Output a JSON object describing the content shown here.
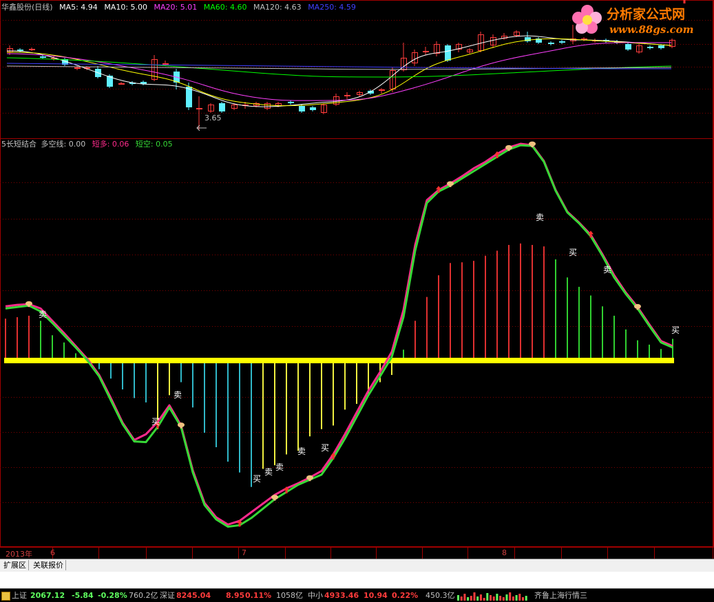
{
  "price_header": {
    "name": "华鑫股份(日线)",
    "ma5": "MA5: 4.94",
    "ma10": "MA10: 5.00",
    "ma20": "MA20: 5.01",
    "ma60": "MA60: 4.60",
    "ma120": "MA120: 4.63",
    "ma250": "MA250: 4.59"
  },
  "indicator_header": {
    "name": "5长短结合",
    "dk": "多空线: 0.00",
    "short_long": "短多: 0.06",
    "short_short": "短空: 0.05"
  },
  "logo": {
    "text": "分析家公式网",
    "url": "www.88gs.com"
  },
  "low_price_label": "3.65",
  "x_axis": {
    "year": "2013年",
    "m6": "6",
    "m7": "7",
    "m8": "8"
  },
  "tabs": [
    "扩展区",
    "关联报价"
  ],
  "status": {
    "sh_label": "上证",
    "sh_val": "2067.12",
    "sh_chg": "-5.84",
    "sh_pct": "-0.28%",
    "sh_amt": "760.2亿",
    "sz_label": "深证",
    "sz_val": "8245.04",
    "sz_chg": "8.95",
    "sz_pct": "0.11%",
    "sz_amt": "1058亿",
    "zx_label": "中小",
    "zx_val": "4933.46",
    "zx_chg": "10.94",
    "zx_pct": "0.22%",
    "zx_amt": "450.3亿",
    "source": "齐鲁上海行情三"
  },
  "signal_labels": {
    "buy": "买",
    "sell": "卖"
  },
  "colors": {
    "bg": "#000000",
    "grid": "#800000",
    "up": "#ff3c3c",
    "down": "#5ff0ff",
    "ma5": "#ffffff",
    "ma10": "#ffff00",
    "ma20": "#ff40ff",
    "ma60": "#00ff00",
    "ma120": "#c0c0c0",
    "ma250": "#4040ff",
    "green_line": "#36d836",
    "magenta_line": "#ff2a8c",
    "zero": "#ffff00"
  },
  "chart_data": {
    "type": "bar",
    "title": "5长短结合",
    "bars": [
      0.58,
      0.6,
      0.62,
      0.55,
      0.35,
      0.25,
      0.1,
      -0.02,
      -0.12,
      -0.25,
      -0.4,
      -0.52,
      -0.58,
      -0.95,
      -0.48,
      -0.3,
      -0.65,
      -1.0,
      -1.2,
      -1.4,
      -1.55,
      -1.75,
      -1.5,
      -1.45,
      -1.3,
      -1.25,
      -1.05,
      -0.95,
      -0.9,
      -0.68,
      -0.6,
      -0.46,
      -0.3,
      -0.2,
      0.15,
      0.55,
      0.88,
      1.18,
      1.35,
      1.36,
      1.38,
      1.45,
      1.52,
      1.6,
      1.62,
      1.6,
      1.58,
      1.4,
      1.15,
      1.02,
      0.9,
      0.75,
      0.62,
      0.43,
      0.28,
      0.22,
      0.16,
      0.3
    ],
    "green_line": [
      0.72,
      0.74,
      0.76,
      0.68,
      0.52,
      0.35,
      0.18,
      0.0,
      -0.22,
      -0.55,
      -0.88,
      -1.12,
      -1.13,
      -0.92,
      -0.65,
      -0.92,
      -1.55,
      -2.0,
      -2.2,
      -2.3,
      -2.28,
      -2.18,
      -2.05,
      -1.92,
      -1.82,
      -1.72,
      -1.65,
      -1.58,
      -1.35,
      -1.08,
      -0.78,
      -0.48,
      -0.22,
      0.05,
      0.6,
      1.52,
      2.18,
      2.34,
      2.42,
      2.52,
      2.62,
      2.72,
      2.82,
      2.92,
      2.98,
      2.97,
      2.75,
      2.35,
      2.05,
      1.9,
      1.72,
      1.45,
      1.15,
      0.92,
      0.72,
      0.48,
      0.25,
      0.18
    ],
    "magenta_line": [
      0.75,
      0.77,
      0.78,
      0.72,
      0.55,
      0.38,
      0.2,
      0.02,
      -0.2,
      -0.52,
      -0.86,
      -1.1,
      -1.02,
      -0.85,
      -0.62,
      -0.9,
      -1.52,
      -1.97,
      -2.17,
      -2.27,
      -2.22,
      -2.1,
      -1.98,
      -1.86,
      -1.77,
      -1.7,
      -1.62,
      -1.53,
      -1.3,
      -1.02,
      -0.72,
      -0.42,
      -0.16,
      0.12,
      0.7,
      1.6,
      2.22,
      2.36,
      2.45,
      2.55,
      2.66,
      2.75,
      2.86,
      2.95,
      3.0,
      2.98,
      2.76,
      2.36,
      2.06,
      1.91,
      1.74,
      1.47,
      1.18,
      0.94,
      0.74,
      0.5,
      0.27,
      0.2
    ],
    "ylim": [
      -2.5,
      3.2
    ]
  }
}
